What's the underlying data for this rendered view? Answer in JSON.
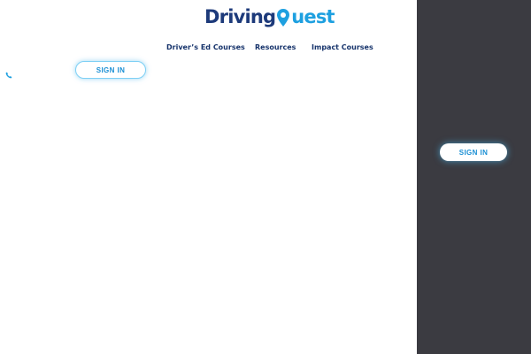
{
  "brand": {
    "logo_part1": "Driving",
    "logo_part2": "uest",
    "logo_pin_icon": "map-pin-icon",
    "colors": {
      "navy": "#1d3a7a",
      "blue": "#1ea0e0"
    }
  },
  "nav": {
    "items": [
      {
        "label": "Driver’s Ed Courses"
      },
      {
        "label": "Resources"
      },
      {
        "label": "Impact Courses"
      }
    ]
  },
  "header": {
    "phone_icon": "phone-icon",
    "signin_label": "SIGN IN"
  },
  "side_panel": {
    "signin_label": "SIGN IN",
    "background": "#3b3b41"
  }
}
